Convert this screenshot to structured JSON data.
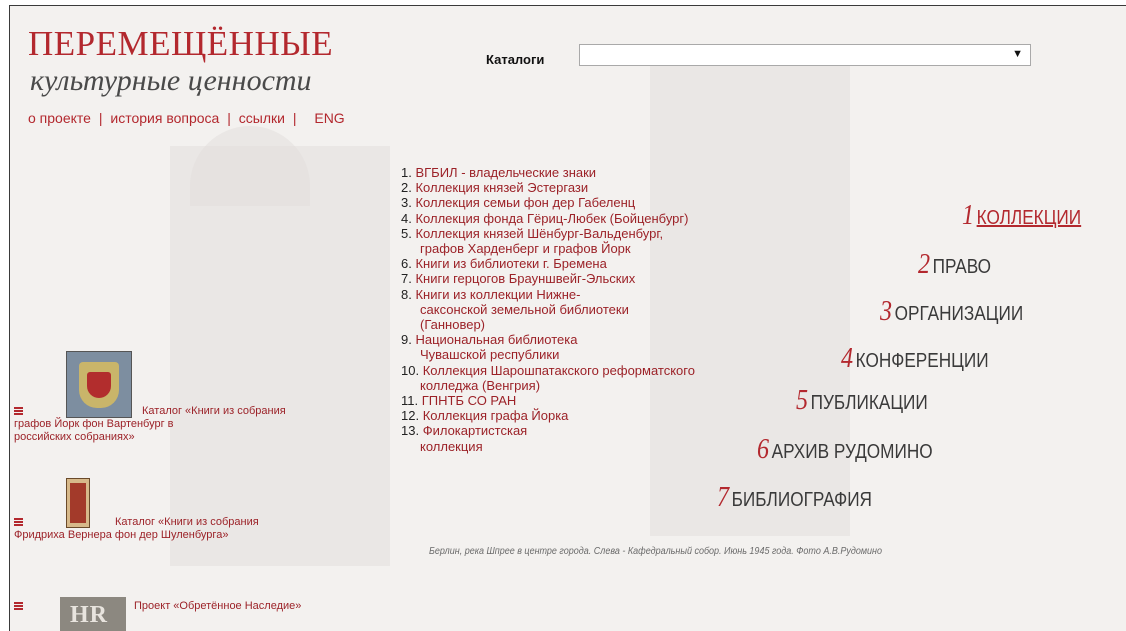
{
  "site": {
    "title": "ПЕРЕМЕЩЁННЫЕ",
    "subtitle": "культурные ценности"
  },
  "topnav": {
    "about": "о проекте",
    "history": "история вопроса",
    "links": "ссылки",
    "sep": "|",
    "eng": "ENG"
  },
  "catalogs": {
    "label": "Каталоги",
    "selected": "",
    "arrow": "▼"
  },
  "collections": [
    {
      "num": "1.",
      "title": "ВГБИЛ - владельческие знаки"
    },
    {
      "num": "2.",
      "title": "Коллекция князей Эстергази"
    },
    {
      "num": "3.",
      "title": "Коллекция семьи фон дер Габеленц"
    },
    {
      "num": "4.",
      "title": "Коллекция фонда Гёриц-Любек (Бойценбург)"
    },
    {
      "num": "5.",
      "title": "Коллекция князей Шёнбург-Вальденбург,",
      "cont": "графов Харденберг и графов Йорк"
    },
    {
      "num": "6.",
      "title": "Книги из библиотеки г. Бремена"
    },
    {
      "num": "7.",
      "title": "Книги герцогов Брауншвейг-Эльских"
    },
    {
      "num": "8.",
      "title": "Книги из коллекции Нижне-",
      "cont": "саксонской земельной библиотеки",
      "cont2": "(Ганновер)"
    },
    {
      "num": "9.",
      "title": "Национальная библиотека",
      "cont": "Чувашской республики"
    },
    {
      "num": "10.",
      "title": "Коллекция Шарошпатакского реформатского",
      "cont": "колледжа (Венгрия)"
    },
    {
      "num": "11.",
      "title": "ГПНТБ СО РАН"
    },
    {
      "num": "12.",
      "title": "Коллекция графа Йорка"
    },
    {
      "num": "13.",
      "title": "Филокартистская",
      "cont": "коллекция"
    }
  ],
  "menu": [
    {
      "num": "1",
      "label": "КОЛЛЕКЦИИ"
    },
    {
      "num": "2",
      "label": "ПРАВО"
    },
    {
      "num": "3",
      "label": "ОРГАНИЗАЦИИ"
    },
    {
      "num": "4",
      "label": "КОНФЕРЕНЦИИ"
    },
    {
      "num": "5",
      "label": "ПУБЛИКАЦИИ"
    },
    {
      "num": "6",
      "label": "АРХИВ РУДОМИНО"
    },
    {
      "num": "7",
      "label": "БИБЛИОГРАФИЯ"
    }
  ],
  "side_catalogs": [
    {
      "line1": "Каталог «Книги из собрания",
      "line2": "графов Йорк фон Вартенбург в",
      "line3": "российских собраниях»"
    },
    {
      "line1": "Каталог «Книги из собрания",
      "line2": "Фридриха Вернера фон дер Шуленбурга»"
    },
    {
      "line1": "Проект «Обретённое Наследие»",
      "logo_text": "HR"
    }
  ],
  "caption": "Берлин, река Шпрее в центре города. Слева - Кафедральный собор. Июнь 1945 года. Фото А.В.Рудомино",
  "colors": {
    "accent": "#b3282e",
    "link": "#9c2228",
    "text": "#3a3a3a"
  }
}
